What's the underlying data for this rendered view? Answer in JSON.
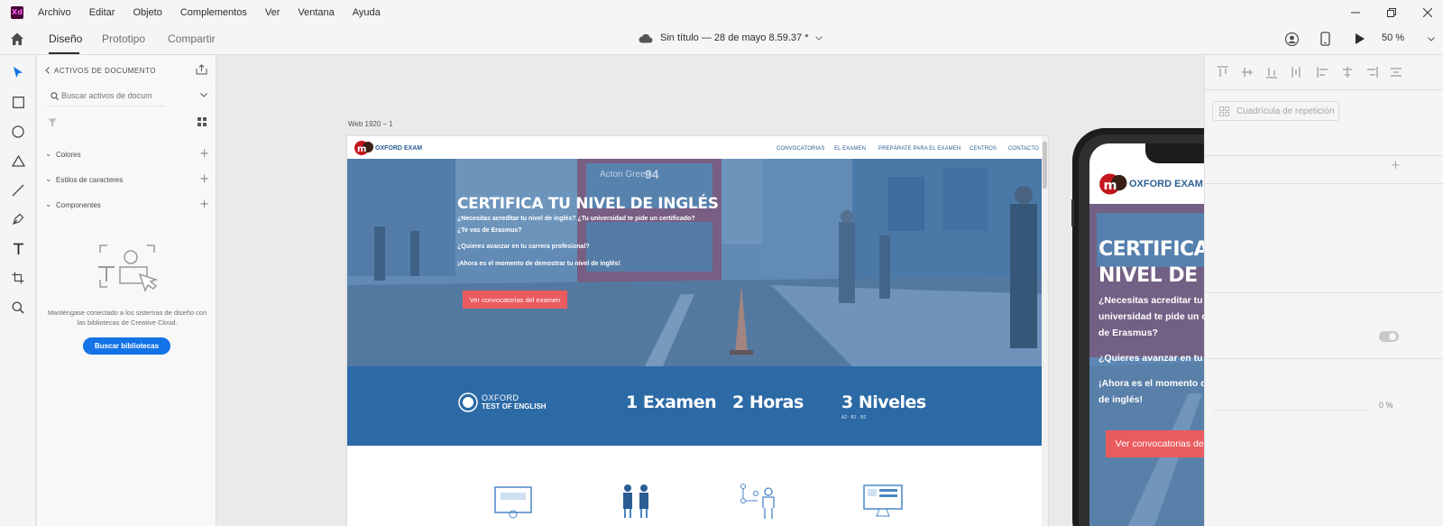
{
  "app": {
    "logo": "Xd",
    "menu": [
      "Archivo",
      "Editar",
      "Objeto",
      "Complementos",
      "Ver",
      "Ventana",
      "Ayuda"
    ]
  },
  "toolbar": {
    "tabs": [
      "Diseño",
      "Prototipo",
      "Compartir"
    ],
    "doc_title": "Sin título — 28 de mayo 8.59.37 *",
    "zoom": "50 %"
  },
  "assets": {
    "header": "ACTIVOS DE DOCUMENTO",
    "search_placeholder": "Buscar activos de docum",
    "sections": [
      "Colores",
      "Estilos de caracteres",
      "Componentes"
    ],
    "empty_message": "Manténgase conectado a los sistemas de diseño con las bibliotecas de Creative Cloud.",
    "cta": "Buscar bibliotecas"
  },
  "props": {
    "repeat_grid": "Cuadrícula de repetición",
    "opacity": "0 %"
  },
  "artboard": {
    "label": "Web 1920 – 1",
    "brand": "OXFORD EXAM",
    "nav": [
      "CONVOCATORIAS",
      "EL EXAMEN",
      "PREPÁRATE PARA EL EXAMEN",
      "CENTROS",
      "CONTACTO"
    ],
    "hero_title": "CERTIFICA TU NIVEL DE INGLÉS",
    "hero_lines": [
      "¿Necesitas acreditar tu nivel de inglés? ¿Tu universidad te pide un certificado?",
      "¿Te vas de Erasmus?",
      "¿Quieres avanzar en tu carrera profesional?",
      "¡Ahora es el momento de demostrar tu nivel de inglés!"
    ],
    "cta": "Ver convocatorias del examen",
    "bus_sign": "Acton Green",
    "bus_number": "94",
    "ote_line1": "OXFORD",
    "ote_line2": "TEST OF ENGLISH",
    "stats": [
      "1 Examen",
      "2 Horas",
      "3 Niveles"
    ],
    "levels": "A2 · B1 · B2"
  },
  "phone": {
    "brand": "OXFORD EXAM",
    "hero_title": "CERTIFICA TU NIVEL DE INGLÉS",
    "p1": "¿Necesitas acreditar tu nivel de inglés? ¿Tu universidad te pide un certificado? ¿Te vas de Erasmus?",
    "p2": "¿Quieres avanzar en tu carrera profesional?",
    "p3": "¡Ahora es el momento de demostrar tu nivel de inglés!",
    "cta": "Ver convocatorias del examen"
  },
  "colors": {
    "accent": "#1473e6",
    "brand_red": "#c4161c",
    "nav_blue": "#2d5f93",
    "band_blue": "#2c6aa6",
    "cta_red": "#ea5b5f",
    "hero_overlay": "#3f78b0"
  },
  "icons": [
    "home-icon",
    "cloud-icon",
    "user-icon",
    "mobile-preview-icon",
    "play-icon",
    "chevron-down-icon",
    "select-tool-icon",
    "rectangle-tool-icon",
    "ellipse-tool-icon",
    "polygon-tool-icon",
    "line-tool-icon",
    "pen-tool-icon",
    "text-tool-icon",
    "artboard-tool-icon",
    "zoom-tool-icon",
    "export-icon",
    "filter-icon",
    "grid-view-icon",
    "hamburger-menu-icon"
  ]
}
